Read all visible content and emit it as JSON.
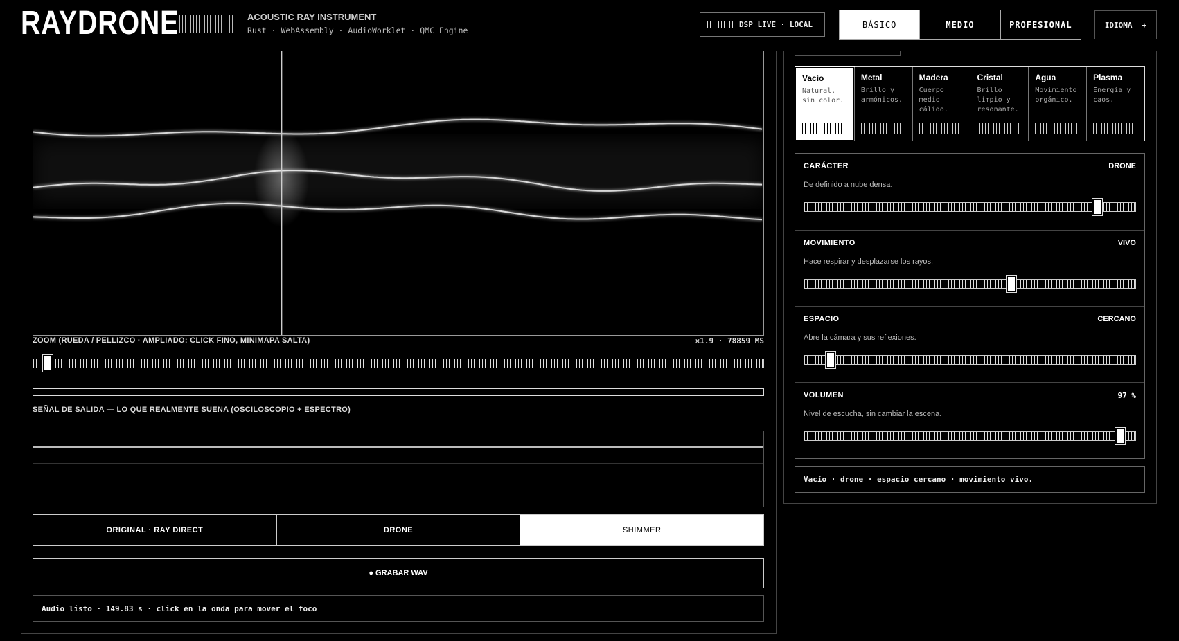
{
  "header": {
    "logo": "RAYDRONE",
    "subtitle": "ACOUSTIC RAY INSTRUMENT",
    "tech": "Rust · WebAssembly · AudioWorklet · QMC Engine",
    "dsp_status": "DSP LIVE · LOCAL",
    "levels": [
      {
        "label": "BÁSICO",
        "active": true
      },
      {
        "label": "MEDIO",
        "active": false
      },
      {
        "label": "PROFESIONAL",
        "active": false
      }
    ],
    "language_label": "IDIOMA",
    "language_plus": "+"
  },
  "waveform": {
    "zoom_label": "ZOOM (RUEDA / PELLIZCO · AMPLIADO: CLICK FINO, MINIMAPA SALTA)",
    "zoom_readout": "×1.9 · 78859 MS",
    "zoom_level": 0.02,
    "focus_fraction": 0.34
  },
  "output": {
    "label": "SEÑAL DE SALIDA — LO QUE REALMENTE SUENA (OSCILOSCOPIO + ESPECTRO)"
  },
  "modes": [
    {
      "label": "ORIGINAL · RAY DIRECT",
      "active": false
    },
    {
      "label": "DRONE",
      "active": false
    },
    {
      "label": "SHIMMER",
      "active": true
    }
  ],
  "record_label": "● GRABAR WAV",
  "status_text": "Audio listo · 149.83 s · click en la onda para mover el foco",
  "materials": [
    {
      "name": "Vacío",
      "desc": "Natural, sin color.",
      "active": true
    },
    {
      "name": "Metal",
      "desc": "Brillo y armónicos.",
      "active": false
    },
    {
      "name": "Madera",
      "desc": "Cuerpo medio cálido.",
      "active": false
    },
    {
      "name": "Cristal",
      "desc": "Brillo limpio y resonante.",
      "active": false
    },
    {
      "name": "Agua",
      "desc": "Movimiento orgánico.",
      "active": false
    },
    {
      "name": "Plasma",
      "desc": "Energía y caos.",
      "active": false
    }
  ],
  "params": [
    {
      "key": "caracter",
      "name": "CARÁCTER",
      "value": "DRONE",
      "desc": "De definido a nube densa.",
      "level": 0.885
    },
    {
      "key": "movimiento",
      "name": "MOVIMIENTO",
      "value": "VIVO",
      "desc": "Hace respirar y desplazarse los rayos.",
      "level": 0.625
    },
    {
      "key": "espacio",
      "name": "ESPACIO",
      "value": "CERCANO",
      "desc": "Abre la cámara y sus reflexiones.",
      "level": 0.08
    },
    {
      "key": "volumen",
      "name": "VOLUMEN",
      "value": "97 %",
      "desc": "Nivel de escucha, sin cambiar la escena.",
      "level": 0.955
    }
  ],
  "summary": "Vacío · drone · espacio cercano · movimiento vivo.",
  "colors": {
    "background": "#000000",
    "foreground": "#ffffff",
    "accent": "#ffffff"
  }
}
